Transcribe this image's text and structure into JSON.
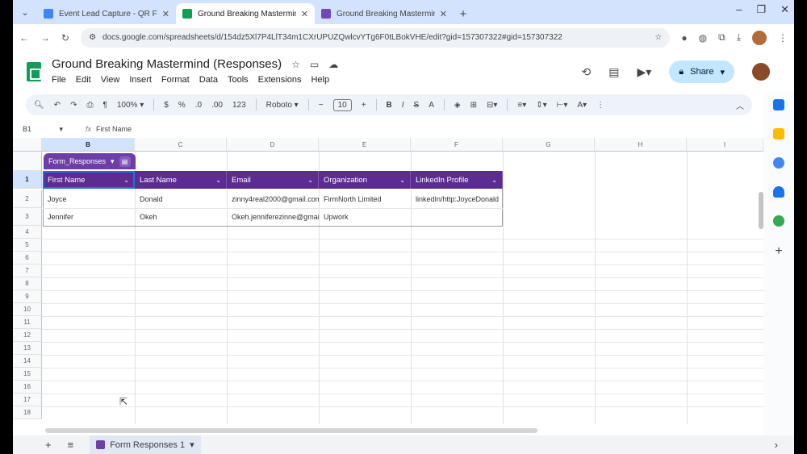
{
  "browser": {
    "tabs": [
      {
        "title": "Event Lead Capture - QR Form",
        "color": "#4285f4",
        "active": false
      },
      {
        "title": "Ground Breaking Mastermind (Responses)",
        "color": "#0f9d58",
        "active": true
      },
      {
        "title": "Ground Breaking Mastermind",
        "color": "#7248b9",
        "active": false
      }
    ],
    "url": "docs.google.com/spreadsheets/d/154dz5Xl7P4LlT34m1CXrUPUZQwlcvYTg6F0tLBokVHE/edit?gid=157307322#gid=157307322"
  },
  "doc": {
    "title": "Ground Breaking Mastermind (Responses)",
    "menu": [
      "File",
      "Edit",
      "View",
      "Insert",
      "Format",
      "Data",
      "Tools",
      "Extensions",
      "Help"
    ],
    "share_label": "Share"
  },
  "toolbar": {
    "zoom": "100%",
    "currency": "$",
    "percent": "%",
    "dec_dec": ".0",
    "dec_inc": ".00",
    "number_fmt": "123",
    "font": "Roboto",
    "font_size": "10"
  },
  "formula_bar": {
    "cell_ref": "B1",
    "fx": "fx",
    "content": "First Name"
  },
  "grid": {
    "columns": [
      "B",
      "C",
      "D",
      "E",
      "F",
      "G",
      "H",
      "I"
    ],
    "rows": [
      "1",
      "2",
      "3",
      "4",
      "5",
      "6",
      "7",
      "8",
      "9",
      "10",
      "11",
      "12",
      "13",
      "14",
      "15",
      "16",
      "17",
      "18"
    ],
    "table_name": "Form_Responses",
    "headers": [
      "First Name",
      "Last Name",
      "Email",
      "Organization",
      "LinkedIn  Profile"
    ],
    "data": [
      [
        "Joyce",
        "Donald",
        "zinny4real2000@gmail.com",
        "FirmNorth Limited",
        "linkedIn/http:JoyceDonald"
      ],
      [
        "Jennifer",
        "Okeh",
        "Okeh.jenniferezinne@gmail.com",
        "Upwork",
        ""
      ]
    ]
  },
  "bottom": {
    "sheet_tab": "Form Responses 1",
    "add": "+",
    "all_sheets": "≡"
  }
}
